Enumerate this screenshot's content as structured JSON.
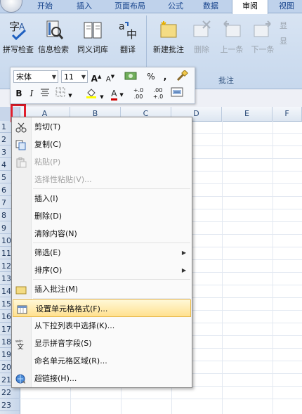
{
  "ribbon": {
    "tabs": [
      "开始",
      "插入",
      "页面布局",
      "公式",
      "数据",
      "审阅",
      "视图"
    ],
    "active_tab": "审阅",
    "proofing": [
      {
        "label": "拼写检查",
        "icon": "spell-check-icon"
      },
      {
        "label": "信息检索",
        "icon": "research-icon"
      },
      {
        "label": "同义词库",
        "icon": "thesaurus-icon"
      },
      {
        "label": "翻译",
        "icon": "translate-icon"
      }
    ],
    "comments": [
      {
        "label": "新建批注",
        "icon": "new-comment-icon",
        "enabled": true
      },
      {
        "label": "删除",
        "icon": "delete-comment-icon",
        "enabled": false
      },
      {
        "label": "上一条",
        "icon": "previous-comment-icon",
        "enabled": false
      },
      {
        "label": "下一条",
        "icon": "next-comment-icon",
        "enabled": false
      }
    ],
    "comments_group_label": "批注",
    "show_partial": [
      "显",
      "显"
    ]
  },
  "mini_toolbar": {
    "font_name": "宋体",
    "font_size": "11",
    "grow_font": "A",
    "shrink_font": "A",
    "percent": "%",
    "comma": ",",
    "bold": "B",
    "italic": "I",
    "font_color_letter": "A",
    "dec_increase": "+.0 .00",
    "dec_decrease": ".00 +.0"
  },
  "sheet": {
    "columns": [
      "A",
      "B",
      "C",
      "D",
      "E",
      "F"
    ],
    "rows": [
      "1",
      "2",
      "3",
      "4",
      "5",
      "6",
      "7",
      "8",
      "9",
      "10",
      "11",
      "12",
      "13",
      "14",
      "15",
      "16",
      "17",
      "18",
      "19",
      "20",
      "21",
      "22",
      "23"
    ]
  },
  "context_menu": {
    "items": [
      {
        "label": "剪切(T)",
        "icon": "cut-icon",
        "enabled": true
      },
      {
        "label": "复制(C)",
        "icon": "copy-icon",
        "enabled": true
      },
      {
        "label": "粘贴(P)",
        "icon": "paste-icon",
        "enabled": false
      },
      {
        "label": "选择性粘贴(V)...",
        "icon": "",
        "enabled": false
      },
      {
        "label": "插入(I)",
        "icon": "",
        "enabled": true
      },
      {
        "label": "删除(D)",
        "icon": "",
        "enabled": true
      },
      {
        "label": "清除内容(N)",
        "icon": "",
        "enabled": true
      },
      {
        "label": "筛选(E)",
        "icon": "",
        "enabled": true,
        "submenu": true
      },
      {
        "label": "排序(O)",
        "icon": "",
        "enabled": true,
        "submenu": true
      },
      {
        "label": "插入批注(M)",
        "icon": "insert-comment-icon",
        "enabled": true
      },
      {
        "label": "设置单元格格式(F)...",
        "icon": "format-cells-icon",
        "enabled": true,
        "highlighted": true
      },
      {
        "label": "从下拉列表中选择(K)...",
        "icon": "",
        "enabled": true
      },
      {
        "label": "显示拼音字段(S)",
        "icon": "phonetic-icon",
        "enabled": true
      },
      {
        "label": "命名单元格区域(R)...",
        "icon": "",
        "enabled": true
      },
      {
        "label": "超链接(H)...",
        "icon": "hyperlink-icon",
        "enabled": true
      }
    ]
  },
  "colors": {
    "highlight_border": "#e21e2b",
    "menu_highlight": "#ffe18f"
  }
}
